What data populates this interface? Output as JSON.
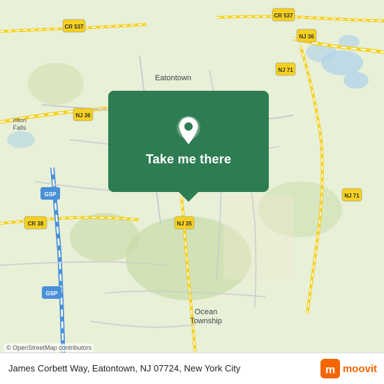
{
  "map": {
    "alt": "Map of Eatontown, NJ area",
    "background_color": "#e8f0d8"
  },
  "cta": {
    "label": "Take me there",
    "pin_icon": "location-pin"
  },
  "bottom_bar": {
    "address": "James Corbett Way, Eatontown, NJ 07724, New York City",
    "osm_attribution": "© OpenStreetMap contributors"
  },
  "moovit": {
    "logo_text": "moovit"
  },
  "road_labels": [
    "CR 537",
    "CR 537",
    "NJ 36",
    "NJ 71",
    "NJ 71",
    "NJ 35",
    "NJ 36",
    "CR 38",
    "GSP",
    "GSP"
  ],
  "place_labels": [
    "Eatontown",
    "Ocean Township",
    "inton Falls"
  ]
}
